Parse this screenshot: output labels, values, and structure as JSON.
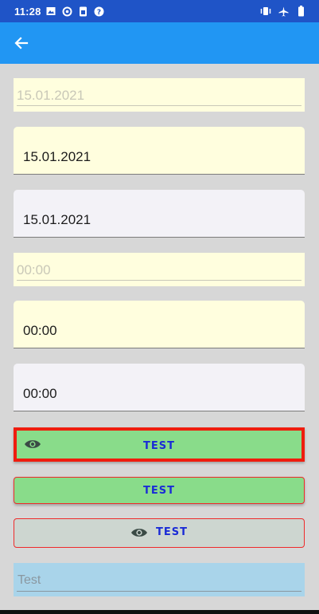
{
  "status_bar": {
    "time": "11:28",
    "left_icons": [
      "image-icon",
      "data-saver-icon",
      "sim-card-icon",
      "help-icon"
    ],
    "right_icons": [
      "vibrate-icon",
      "airplane-icon",
      "battery-icon"
    ]
  },
  "app_bar": {
    "color": "#2196f3",
    "back_icon": "arrow-left-icon"
  },
  "fields": {
    "date_compact": "15.01.2021",
    "date_filled_yellow": "15.01.2021",
    "date_filled_grey": "15.01.2021",
    "time_compact": "00:00",
    "time_filled_yellow": "00:00",
    "time_filled_grey": "00:00",
    "text_placeholder": "Test"
  },
  "buttons": {
    "button1_label": "TEST",
    "button2_label": "TEST",
    "button3_label": "TEST",
    "button_icon": "eye-icon"
  },
  "colors": {
    "status_bar": "#1f54c7",
    "entry_yellow": "#fffede",
    "entry_grey": "#f3f2f7",
    "button_green": "#89dc8a",
    "button_grey": "#cdd6d0",
    "border_red": "#ef1d0e",
    "label_blue": "#1a2bd6",
    "entry_blue": "#a9d4ea",
    "page_bg": "#d7d7d7"
  }
}
